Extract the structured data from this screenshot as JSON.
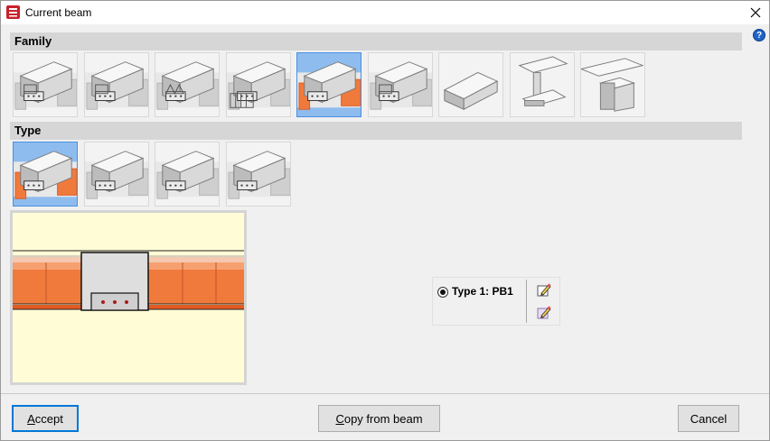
{
  "window": {
    "title": "Current beam"
  },
  "sections": {
    "family_label": "Family",
    "type_label": "Type"
  },
  "family": {
    "items": [
      {
        "icon": "hollow-core-beam-icon"
      },
      {
        "icon": "box-beam-icon"
      },
      {
        "icon": "triangular-void-beam-icon"
      },
      {
        "icon": "waffle-beam-icon"
      },
      {
        "icon": "prestressed-beam-icon"
      },
      {
        "icon": "hollow-box-beam-icon"
      },
      {
        "icon": "solid-beam-icon"
      },
      {
        "icon": "steel-i-beam-icon"
      },
      {
        "icon": "rectangular-beam-icon"
      }
    ],
    "selected_index": 4
  },
  "type": {
    "items": [
      {
        "icon": "type-1-beam-icon"
      },
      {
        "icon": "type-2-beam-icon"
      },
      {
        "icon": "type-3-beam-icon"
      },
      {
        "icon": "type-4-beam-icon"
      }
    ],
    "selected_index": 0,
    "current_label": "Type 1: PB1"
  },
  "buttons": {
    "accept_first": "A",
    "accept_rest": "ccept",
    "copy_first": "C",
    "copy_rest": "opy from beam",
    "cancel": "Cancel"
  },
  "colors": {
    "selected_bg": "#8fbcee",
    "orange": "#f07a3c",
    "preview_bg": "#fffcd6",
    "accent": "#0078d7"
  }
}
